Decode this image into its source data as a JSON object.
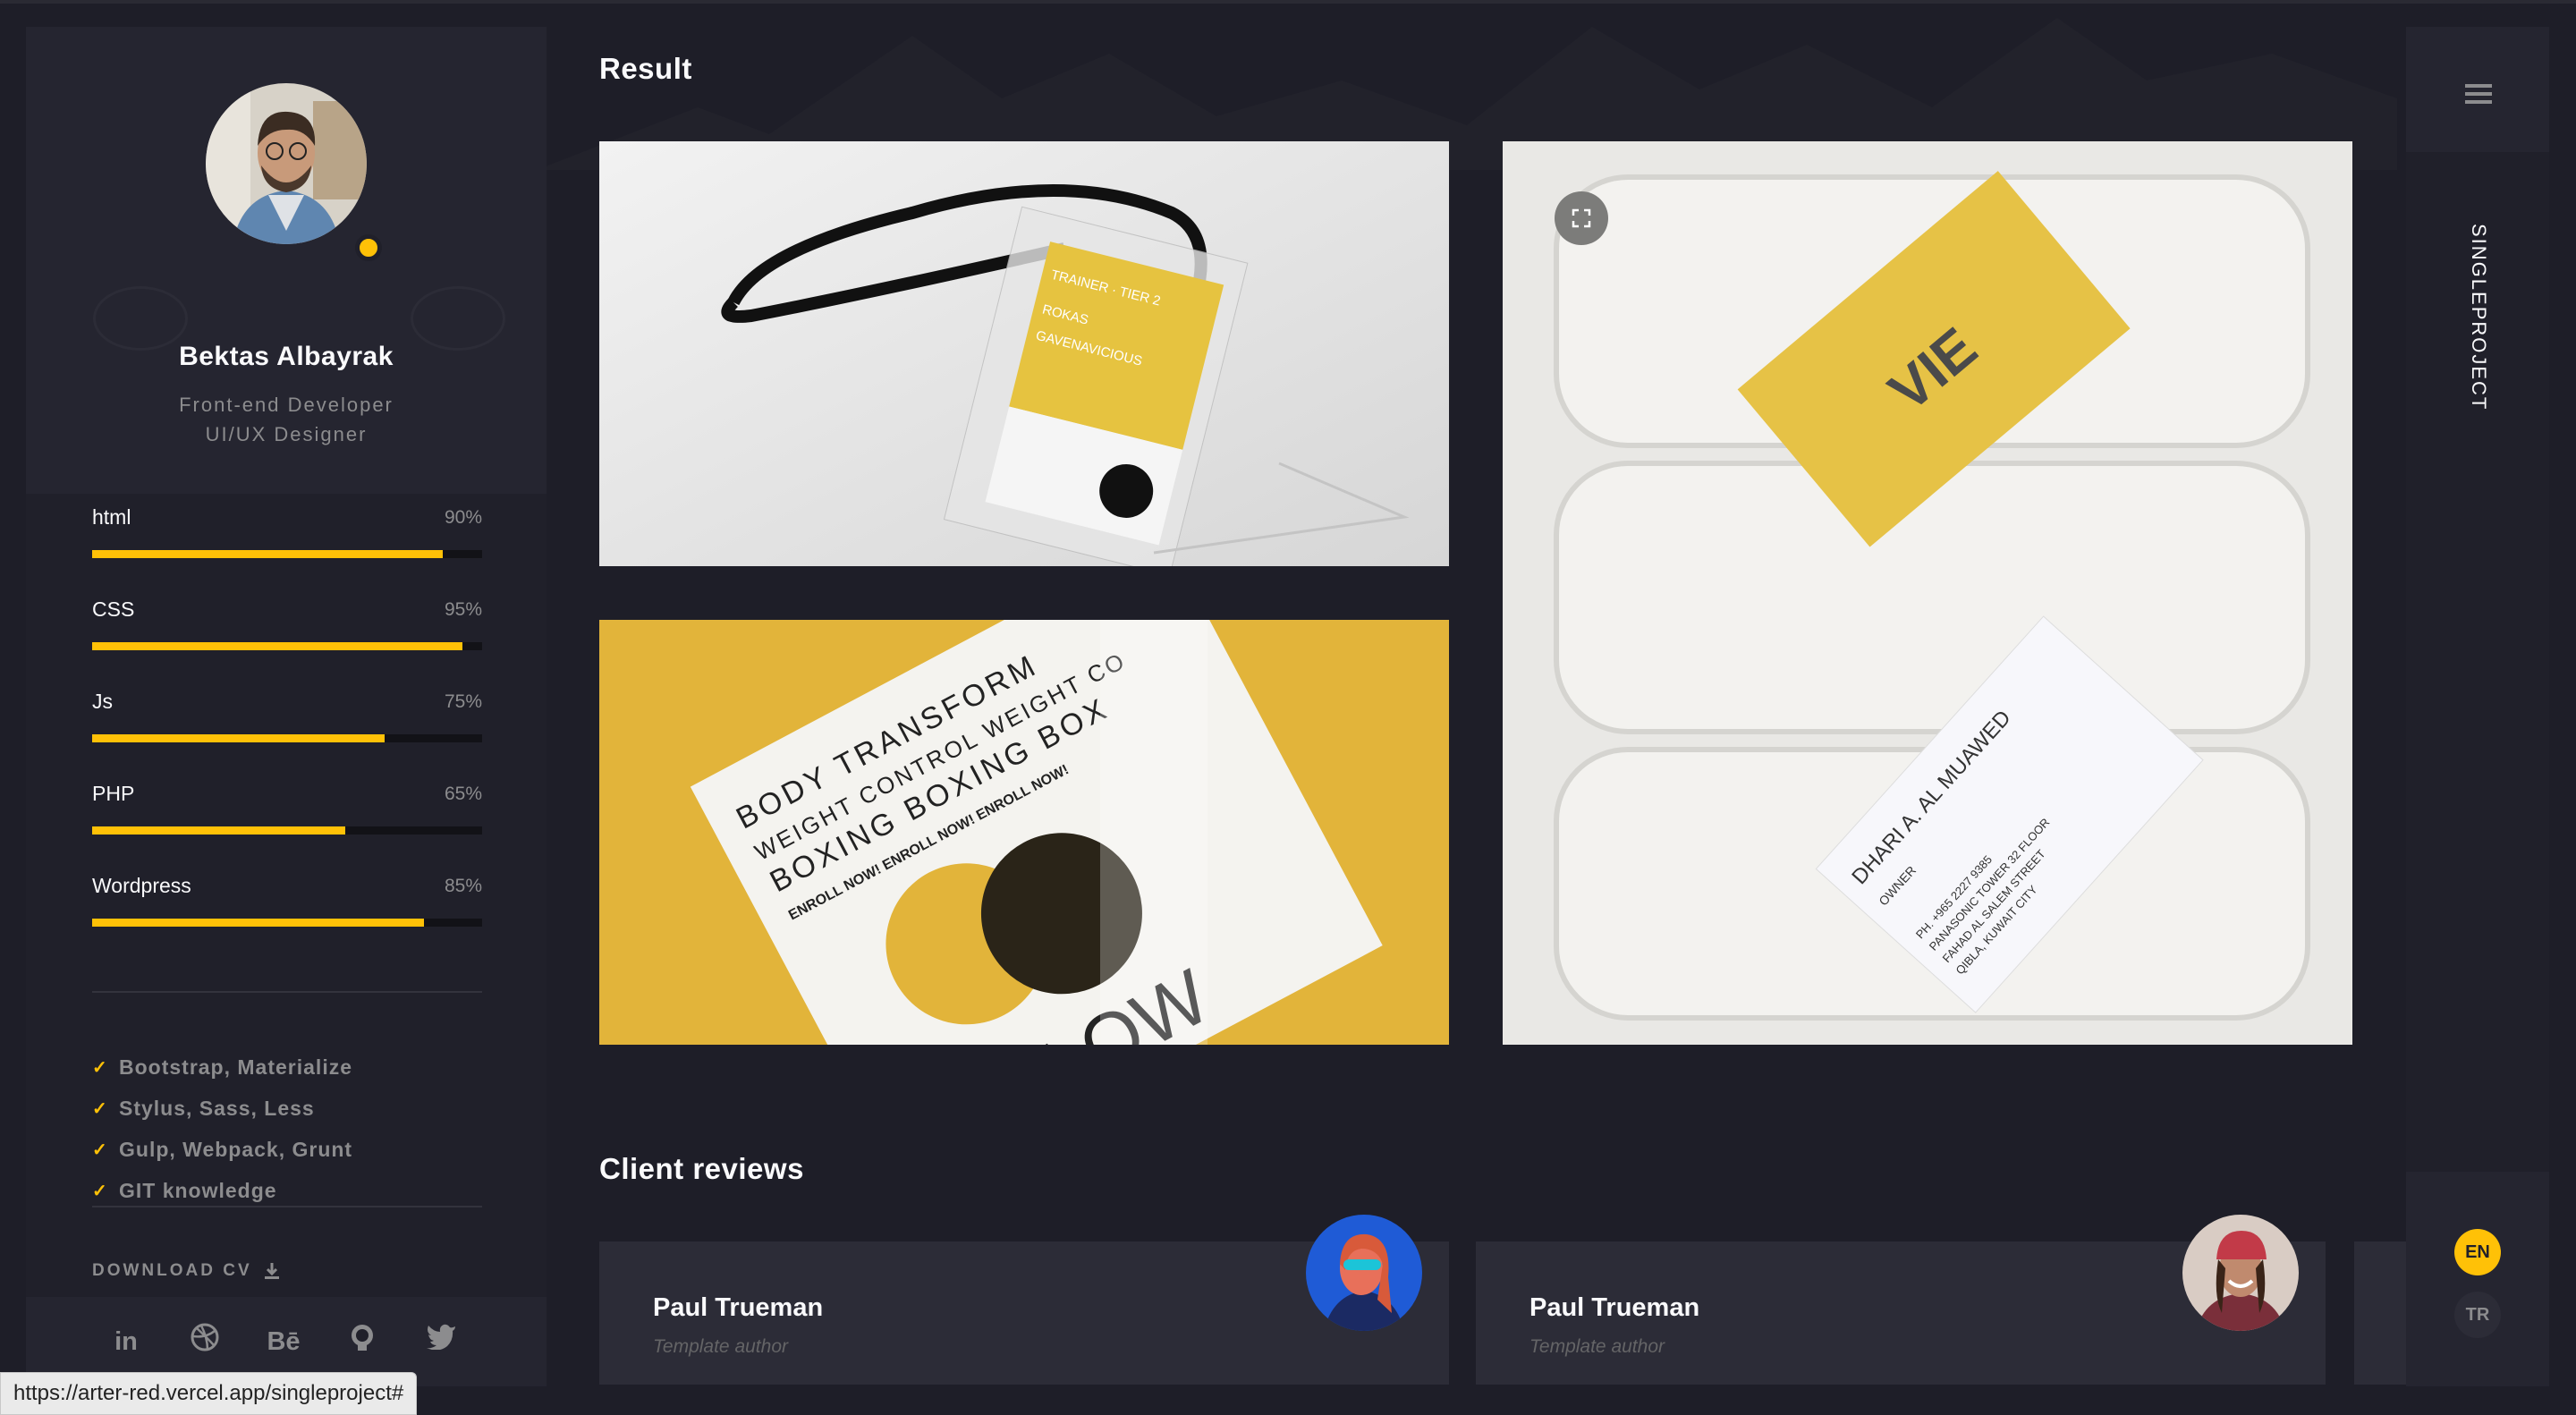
{
  "profile": {
    "name": "Bektas Albayrak",
    "role_line1": "Front-end Developer",
    "role_line2": "UI/UX Designer"
  },
  "skills": [
    {
      "name": "html",
      "percent": "90%",
      "level": 0.9
    },
    {
      "name": "CSS",
      "percent": "95%",
      "level": 0.95
    },
    {
      "name": "Js",
      "percent": "75%",
      "level": 0.75
    },
    {
      "name": "PHP",
      "percent": "65%",
      "level": 0.65
    },
    {
      "name": "Wordpress",
      "percent": "85%",
      "level": 0.85
    }
  ],
  "knowledge": [
    "Bootstrap, Materialize",
    "Stylus, Sass, Less",
    "Gulp, Webpack, Grunt",
    "GIT knowledge"
  ],
  "download_label": "DOWNLOAD CV",
  "social_icons": [
    "linkedin-icon",
    "dribbble-icon",
    "behance-icon",
    "github-icon",
    "twitter-icon"
  ],
  "social": {
    "linkedin": "in",
    "behance": "Bē"
  },
  "main": {
    "result_title": "Result",
    "reviews_title": "Client reviews",
    "reviews": [
      {
        "name": "Paul Trueman",
        "role": "Template author"
      },
      {
        "name": "Paul Trueman",
        "role": "Template author"
      }
    ]
  },
  "gallery": {
    "badge": {
      "line1": "TRAINER · TIER 2",
      "line2": "ROKAS",
      "line3": "GAVENAVICIOUS"
    },
    "flyer": {
      "lines": [
        "BODY TRANSFORM",
        "WEIGHT CONTROL  WEIGHT CO",
        "BOXING  BOXING  BOX",
        "ENROLL NOW!  ENROLL NOW!  ENROLL NOW!"
      ],
      "big": "FLOW"
    },
    "card": {
      "brand": "VIE",
      "name": "DHARI A. AL MUAWED",
      "title": "OWNER",
      "phone": "PH. +965 2227 9385",
      "addr1": "PANASONIC TOWER 32 FLOOR",
      "addr2": "FAHAD AL SALEM STREET",
      "addr3": "QIBLA, KUWAIT CITY"
    }
  },
  "rightbar": {
    "page_label": "SINGLEPROJECT",
    "lang_active": "EN",
    "lang_other": "TR"
  },
  "status_url": "https://arter-red.vercel.app/singleproject#",
  "colors": {
    "accent": "#ffc107",
    "background": "#1e1e28",
    "panel": "#252530",
    "card": "#2c2c37"
  }
}
